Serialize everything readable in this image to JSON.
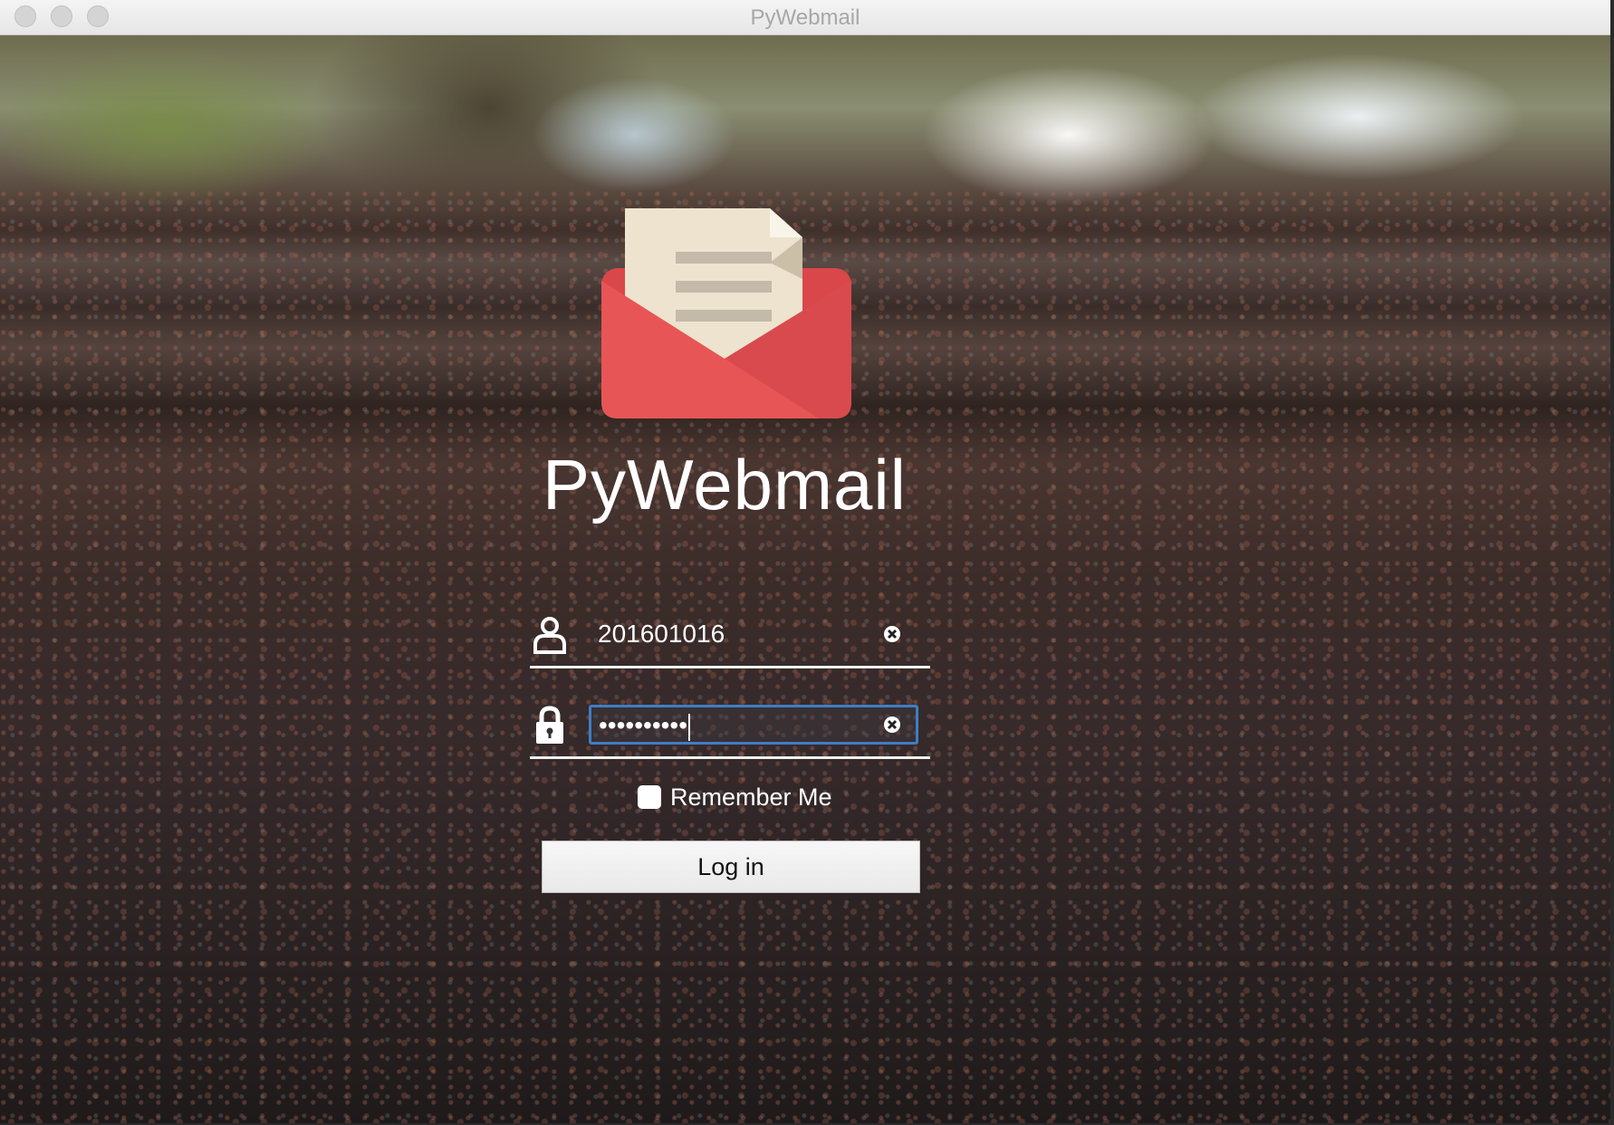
{
  "window": {
    "title": "PyWebmail"
  },
  "app": {
    "name": "PyWebmail",
    "logo_icon": "open-envelope-icon"
  },
  "login": {
    "username_value": "201601016",
    "password_mask": "••••••••••",
    "remember_label": "Remember Me",
    "remember_checked": false,
    "login_label": "Log in"
  },
  "icons": {
    "user": "user-icon",
    "lock": "lock-icon",
    "clear": "clear-icon"
  },
  "colors": {
    "envelope_red": "#E85556",
    "letter_paper": "#EDE3CF",
    "focus_ring": "#3D7EC6"
  }
}
